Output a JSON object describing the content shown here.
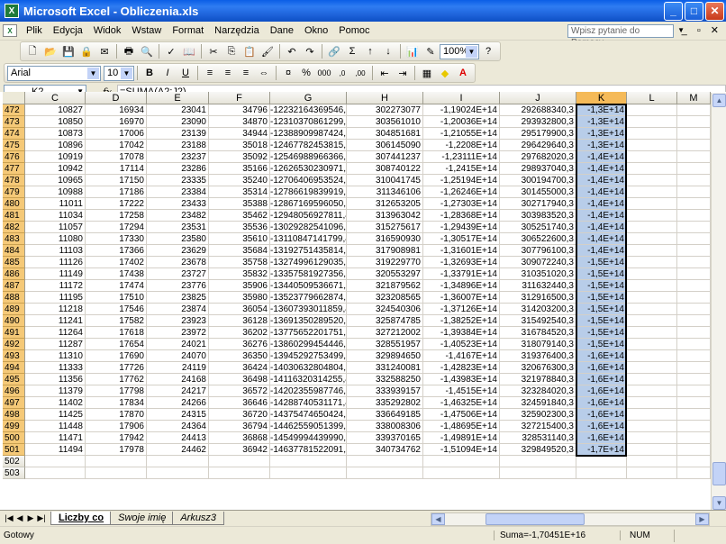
{
  "window": {
    "title": "Microsoft Excel - Obliczenia.xls",
    "app_icon": "excel-icon",
    "buttons": [
      "minimize",
      "maximize",
      "close"
    ]
  },
  "menu": {
    "items": [
      "Plik",
      "Edycja",
      "Widok",
      "Wstaw",
      "Format",
      "Narzędzia",
      "Dane",
      "Okno",
      "Pomoc"
    ],
    "help_placeholder": "Wpisz pytanie do Pomocy"
  },
  "toolbar": {
    "zoom": "100%",
    "font_name": "Arial",
    "font_size": "10",
    "bold": "B",
    "italic": "I",
    "underline": "U",
    "sigma": "Σ",
    "percent": "%",
    "thousands": "000",
    "inc_dec": ",0",
    "dec_dec": ",00"
  },
  "formula_bar": {
    "name_box": "K2",
    "fx_label": "fx",
    "formula": "=SUMA(A2:J2)"
  },
  "columns": [
    "C",
    "D",
    "E",
    "F",
    "G",
    "H",
    "I",
    "J",
    "K",
    "L",
    "M"
  ],
  "selected_column": "K",
  "rows": [
    {
      "n": "472",
      "c": [
        "10827",
        "16934",
        "23041",
        "34796",
        "-12232164369546,4",
        "302273077",
        "-1,19024E+14",
        "292688340,3",
        "-1,3E+14"
      ]
    },
    {
      "n": "473",
      "c": [
        "10850",
        "16970",
        "23090",
        "34870",
        "-12310370861299,4",
        "303561010",
        "-1,20036E+14",
        "293932800,3",
        "-1,3E+14"
      ]
    },
    {
      "n": "474",
      "c": [
        "10873",
        "17006",
        "23139",
        "34944",
        "-12388909987424,4",
        "304851681",
        "-1,21055E+14",
        "295179900,3",
        "-1,3E+14"
      ]
    },
    {
      "n": "475",
      "c": [
        "10896",
        "17042",
        "23188",
        "35018",
        "-12467782453815,4",
        "306145090",
        "-1,2208E+14",
        "296429640,3",
        "-1,3E+14"
      ]
    },
    {
      "n": "476",
      "c": [
        "10919",
        "17078",
        "23237",
        "35092",
        "-12546988966366,4",
        "307441237",
        "-1,23111E+14",
        "297682020,3",
        "-1,4E+14"
      ]
    },
    {
      "n": "477",
      "c": [
        "10942",
        "17114",
        "23286",
        "35166",
        "-12626530230971,4",
        "308740122",
        "-1,2415E+14",
        "298937040,3",
        "-1,4E+14"
      ]
    },
    {
      "n": "478",
      "c": [
        "10965",
        "17150",
        "23335",
        "35240",
        "-12706406953524,4",
        "310041745",
        "-1,25194E+14",
        "300194700,3",
        "-1,4E+14"
      ]
    },
    {
      "n": "479",
      "c": [
        "10988",
        "17186",
        "23384",
        "35314",
        "-12786619839919,4",
        "311346106",
        "-1,26246E+14",
        "301455000,3",
        "-1,4E+14"
      ]
    },
    {
      "n": "480",
      "c": [
        "11011",
        "17222",
        "23433",
        "35388",
        "-12867169596050,4",
        "312653205",
        "-1,27303E+14",
        "302717940,3",
        "-1,4E+14"
      ]
    },
    {
      "n": "481",
      "c": [
        "11034",
        "17258",
        "23482",
        "35462",
        "-12948056927811,4",
        "313963042",
        "-1,28368E+14",
        "303983520,3",
        "-1,4E+14"
      ]
    },
    {
      "n": "482",
      "c": [
        "11057",
        "17294",
        "23531",
        "35536",
        "-13029282541096,4",
        "315275617",
        "-1,29439E+14",
        "305251740,3",
        "-1,4E+14"
      ]
    },
    {
      "n": "483",
      "c": [
        "11080",
        "17330",
        "23580",
        "35610",
        "-13110847141799,4",
        "316590930",
        "-1,30517E+14",
        "306522600,3",
        "-1,4E+14"
      ]
    },
    {
      "n": "484",
      "c": [
        "11103",
        "17366",
        "23629",
        "35684",
        "-13192751435814,4",
        "317908981",
        "-1,31601E+14",
        "307796100,3",
        "-1,4E+14"
      ]
    },
    {
      "n": "485",
      "c": [
        "11126",
        "17402",
        "23678",
        "35758",
        "-13274996129035,4",
        "319229770",
        "-1,32693E+14",
        "309072240,3",
        "-1,5E+14"
      ]
    },
    {
      "n": "486",
      "c": [
        "11149",
        "17438",
        "23727",
        "35832",
        "-13357581927356,4",
        "320553297",
        "-1,33791E+14",
        "310351020,3",
        "-1,5E+14"
      ]
    },
    {
      "n": "487",
      "c": [
        "11172",
        "17474",
        "23776",
        "35906",
        "-13440509536671,4",
        "321879562",
        "-1,34896E+14",
        "311632440,3",
        "-1,5E+14"
      ]
    },
    {
      "n": "488",
      "c": [
        "11195",
        "17510",
        "23825",
        "35980",
        "-13523779662874,4",
        "323208565",
        "-1,36007E+14",
        "312916500,3",
        "-1,5E+14"
      ]
    },
    {
      "n": "489",
      "c": [
        "11218",
        "17546",
        "23874",
        "36054",
        "-13607393011859,4",
        "324540306",
        "-1,37126E+14",
        "314203200,3",
        "-1,5E+14"
      ]
    },
    {
      "n": "490",
      "c": [
        "11241",
        "17582",
        "23923",
        "36128",
        "-13691350289520,4",
        "325874785",
        "-1,38252E+14",
        "315492540,3",
        "-1,5E+14"
      ]
    },
    {
      "n": "491",
      "c": [
        "11264",
        "17618",
        "23972",
        "36202",
        "-13775652201751,4",
        "327212002",
        "-1,39384E+14",
        "316784520,3",
        "-1,5E+14"
      ]
    },
    {
      "n": "492",
      "c": [
        "11287",
        "17654",
        "24021",
        "36276",
        "-13860299454446,4",
        "328551957",
        "-1,40523E+14",
        "318079140,3",
        "-1,5E+14"
      ]
    },
    {
      "n": "493",
      "c": [
        "11310",
        "17690",
        "24070",
        "36350",
        "-13945292753499,4",
        "329894650",
        "-1,4167E+14",
        "319376400,3",
        "-1,6E+14"
      ]
    },
    {
      "n": "494",
      "c": [
        "11333",
        "17726",
        "24119",
        "36424",
        "-14030632804804,4",
        "331240081",
        "-1,42823E+14",
        "320676300,3",
        "-1,6E+14"
      ]
    },
    {
      "n": "495",
      "c": [
        "11356",
        "17762",
        "24168",
        "36498",
        "-14116320314255,4",
        "332588250",
        "-1,43983E+14",
        "321978840,3",
        "-1,6E+14"
      ]
    },
    {
      "n": "496",
      "c": [
        "11379",
        "17798",
        "24217",
        "36572",
        "-14202355987746,4",
        "333939157",
        "-1,4515E+14",
        "323284020,3",
        "-1,6E+14"
      ]
    },
    {
      "n": "497",
      "c": [
        "11402",
        "17834",
        "24266",
        "36646",
        "-14288740531171,4",
        "335292802",
        "-1,46325E+14",
        "324591840,3",
        "-1,6E+14"
      ]
    },
    {
      "n": "498",
      "c": [
        "11425",
        "17870",
        "24315",
        "36720",
        "-14375474650424,4",
        "336649185",
        "-1,47506E+14",
        "325902300,3",
        "-1,6E+14"
      ]
    },
    {
      "n": "499",
      "c": [
        "11448",
        "17906",
        "24364",
        "36794",
        "-14462559051399,4",
        "338008306",
        "-1,48695E+14",
        "327215400,3",
        "-1,6E+14"
      ]
    },
    {
      "n": "500",
      "c": [
        "11471",
        "17942",
        "24413",
        "36868",
        "-14549994439990,4",
        "339370165",
        "-1,49891E+14",
        "328531140,3",
        "-1,6E+14"
      ]
    },
    {
      "n": "501",
      "c": [
        "11494",
        "17978",
        "24462",
        "36942",
        "-14637781522091,4",
        "340734762",
        "-1,51094E+14",
        "329849520,3",
        "-1,7E+14"
      ]
    },
    {
      "n": "502",
      "c": [
        "",
        "",
        "",
        "",
        "",
        "",
        "",
        "",
        ""
      ]
    },
    {
      "n": "503",
      "c": [
        "",
        "",
        "",
        "",
        "",
        "",
        "",
        "",
        ""
      ]
    }
  ],
  "sheets": {
    "tabs": [
      "Liczby co",
      "Swoje imię",
      "Arkusz3"
    ],
    "active": "Liczby co"
  },
  "status": {
    "ready": "Gotowy",
    "sum": "Suma=-1,70451E+16",
    "num": "NUM"
  }
}
